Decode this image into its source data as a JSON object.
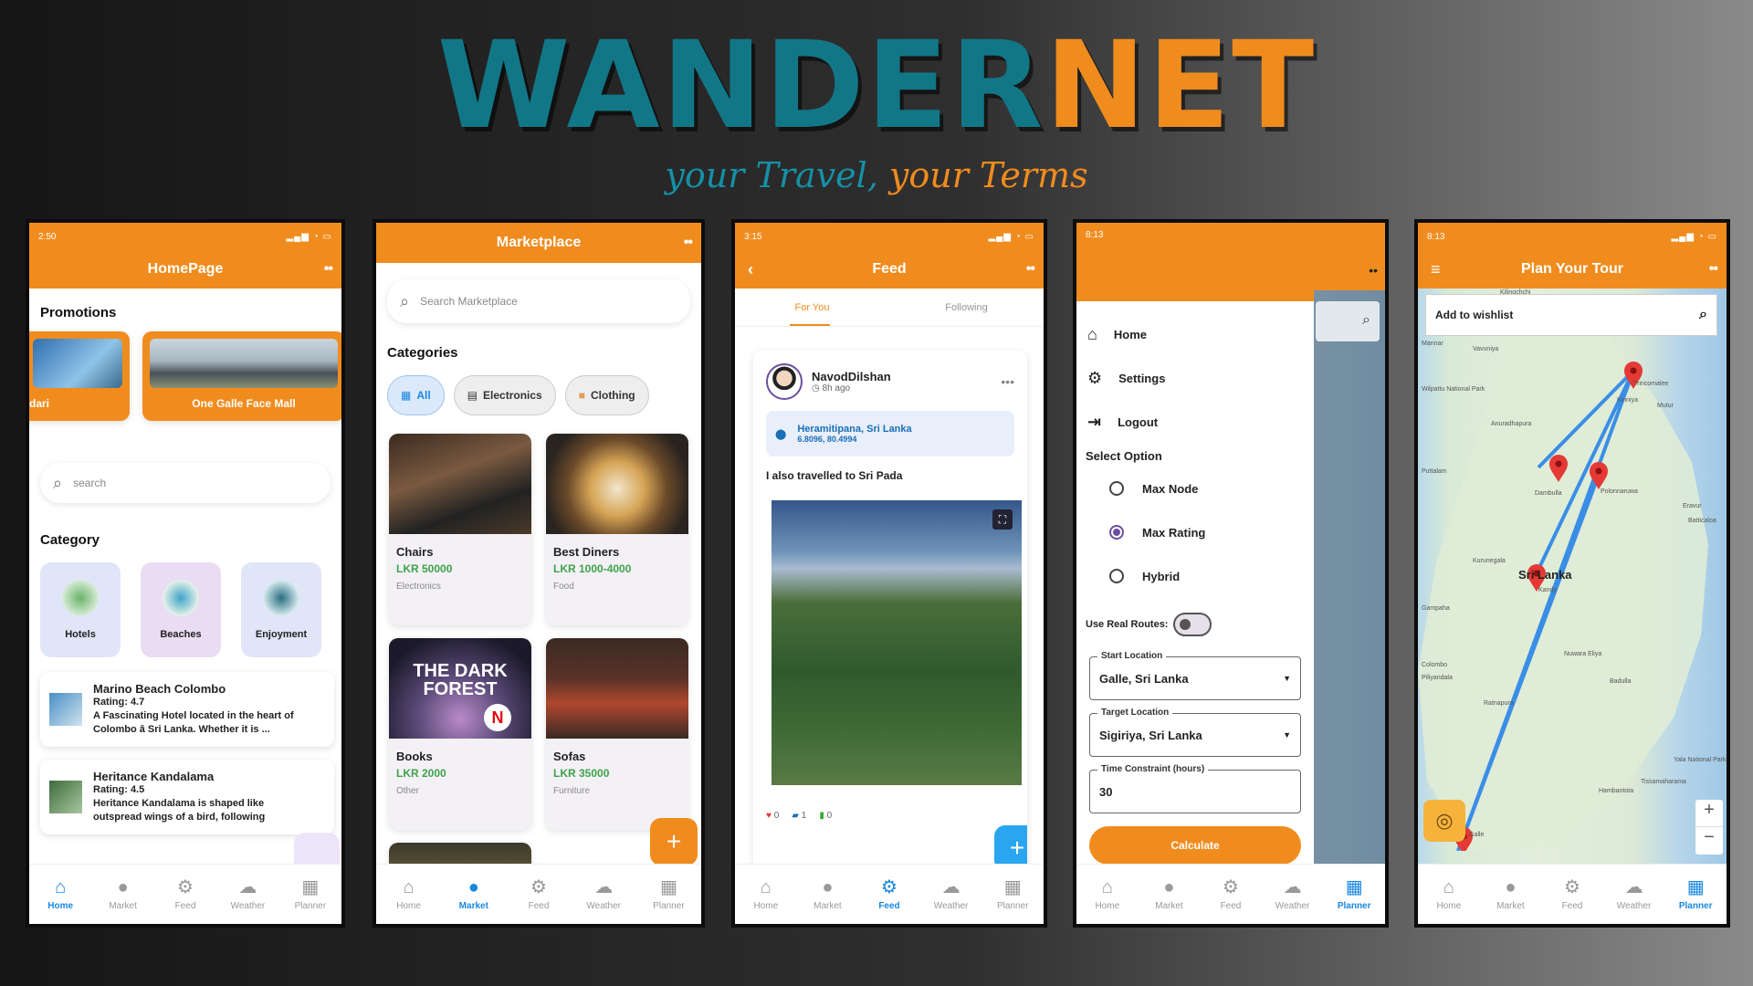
{
  "brand": {
    "part1": "WANDER",
    "part2": "NET",
    "tag_part1": "your Travel,",
    "tag_part2": "your Terms"
  },
  "colors": {
    "accent": "#f08c1e",
    "teal": "#117787",
    "blue": "#1a88e0"
  },
  "nav": {
    "home": "Home",
    "market": "Market",
    "feed": "Feed",
    "weather": "Weather",
    "planner": "Planner"
  },
  "home": {
    "time": "2:50",
    "title": "HomePage",
    "promotions_title": "Promotions",
    "promo1": "dari",
    "promo2": "One Galle Face Mall",
    "search_placeholder": "search",
    "category_title": "Category",
    "categories": [
      "Hotels",
      "Beaches",
      "Enjoyment"
    ],
    "hotels": [
      {
        "name": "Marino Beach Colombo",
        "rating": "Rating: 4.7",
        "desc": "A Fascinating Hotel located in the heart of Colombo â Sri Lanka. Whether it is ..."
      },
      {
        "name": "Heritance Kandalama",
        "rating": "Rating: 4.5",
        "desc": "Heritance Kandalama is shaped like outspread wings of a bird, following"
      }
    ]
  },
  "market": {
    "title": "Marketplace",
    "search_placeholder": "Search Marketplace",
    "categories_title": "Categories",
    "chips": [
      "All",
      "Electronics",
      "Clothing"
    ],
    "items": [
      {
        "name": "Chairs",
        "price": "LKR 50000",
        "cat": "Electronics"
      },
      {
        "name": "Best Diners",
        "price": "LKR 1000-4000",
        "cat": "Food"
      },
      {
        "name": "Books",
        "price": "LKR 2000",
        "cat": "Other"
      },
      {
        "name": "Sofas",
        "price": "LKR 35000",
        "cat": "Furniture"
      }
    ],
    "book_line1": "THE DARK",
    "book_line2": "FOREST",
    "book_badge": "N"
  },
  "feed": {
    "time": "3:15",
    "title": "Feed",
    "tab1": "For You",
    "tab2": "Following",
    "user": "NavodDilshan",
    "ago": "8h ago",
    "location": "Heramitipana, Sri Lanka",
    "coords": "6.8096, 80.4994",
    "text": "I also travelled to Sri Pada",
    "likes": "0",
    "comments": "1",
    "saves": "0"
  },
  "planner": {
    "time": "8:13",
    "menu": [
      "Home",
      "Settings",
      "Logout"
    ],
    "select_option": "Select Option",
    "options": [
      "Max Node",
      "Max Rating",
      "Hybrid"
    ],
    "selected_option": "Max Rating",
    "real_routes": "Use Real Routes:",
    "start_label": "Start Location",
    "start_value": "Galle, Sri Lanka",
    "target_label": "Target Location",
    "target_value": "Sigiriya, Sri Lanka",
    "time_label": "Time Constraint (hours)",
    "time_value": "30",
    "calculate": "Calculate"
  },
  "map": {
    "time": "8:13",
    "title": "Plan Your Tour",
    "wishlist_placeholder": "Add to wishlist",
    "country": "Sri Lanka",
    "places": [
      "Kilinochchi",
      "Vavuniya",
      "Mannar",
      "Wilpattu National Park",
      "Anuradhapura",
      "Trincomalee",
      "Kinniya",
      "Mutur",
      "Dambulla",
      "Polonnaruwa",
      "Puttalam",
      "Kurunegala",
      "Kandy",
      "Gampaha",
      "Colombo",
      "Nuwara Eliya",
      "Badulla",
      "Piliyandala",
      "Ratnapura",
      "Galle",
      "Hambantota",
      "Yala National Park",
      "Tissamaharama",
      "Batticaloa",
      "Eravur"
    ]
  }
}
